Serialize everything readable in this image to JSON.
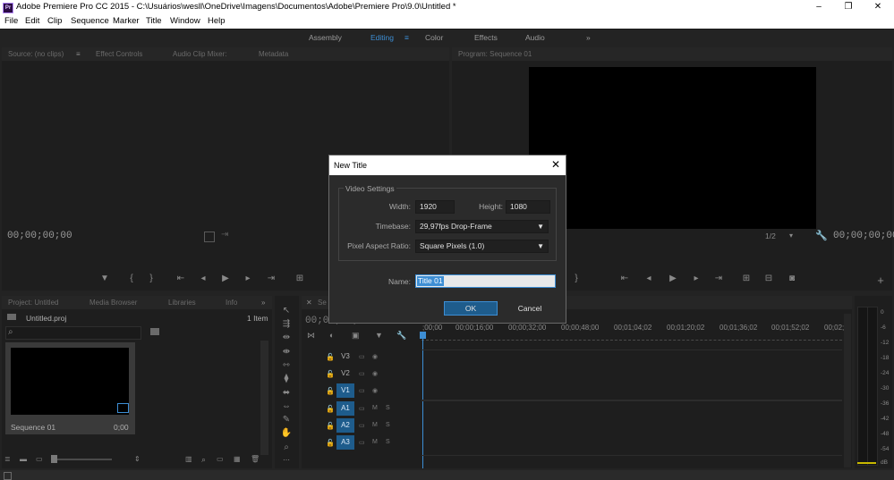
{
  "window": {
    "title": "Adobe Premiere Pro CC 2015 - C:\\Usuários\\wesll\\OneDrive\\Imagens\\Documentos\\Adobe\\Premiere Pro\\9.0\\Untitled *",
    "app_icon": "Pr",
    "minimize": "–",
    "restore": "❐",
    "close": "✕"
  },
  "menu": [
    "File",
    "Edit",
    "Clip",
    "Sequence",
    "Marker",
    "Title",
    "Window",
    "Help"
  ],
  "workspaces": {
    "items": [
      "Assembly",
      "Editing",
      "Color",
      "Effects",
      "Audio"
    ],
    "active": "Editing",
    "more": "»",
    "active_menu": "≡"
  },
  "source_panel": {
    "tabs": [
      "Source: (no clips)",
      "Effect Controls",
      "Audio Clip Mixer:",
      "Metadata"
    ],
    "tab_menu": "≡",
    "timecode": "00;00;00;00"
  },
  "program_panel": {
    "tab": "Program: Sequence 01",
    "timecode_right": "00;00;00;00",
    "zoom": "1/2",
    "add": "+"
  },
  "project_panel": {
    "tabs": [
      "Project: Untitled",
      "Media Browser",
      "Libraries",
      "Info"
    ],
    "more": "»",
    "file": "Untitled.proj",
    "count": "1 Item",
    "search_icon": "⌕",
    "thumb": {
      "name": "Sequence 01",
      "duration": "0;00"
    }
  },
  "timeline": {
    "tab_partial": "Se",
    "timecode_partial": "00;00;00;00",
    "ruler": [
      ";00;00",
      "00;00;16;00",
      "00;00;32;00",
      "00;00;48;00",
      "00;01;04;02",
      "00;01;20;02",
      "00;01;36;02",
      "00;01;52;02",
      "00;02;"
    ],
    "video_tracks": [
      "V3",
      "V2",
      "V1"
    ],
    "audio_tracks": [
      "A1",
      "A2",
      "A3"
    ],
    "active_tracks": [
      "V1",
      "A1",
      "A2",
      "A3"
    ],
    "m_label": "M",
    "s_label": "S"
  },
  "audio_meter": {
    "labels": [
      "0",
      "-6",
      "-12",
      "-18",
      "-24",
      "-30",
      "-36",
      "-42",
      "-48",
      "-54",
      "dB"
    ]
  },
  "dialog": {
    "title": "New Title",
    "close": "✕",
    "group_title": "Video Settings",
    "width_label": "Width:",
    "width_value": "1920",
    "height_label": "Height:",
    "height_value": "1080",
    "timebase_label": "Timebase:",
    "timebase_value": "29,97fps Drop-Frame",
    "par_label": "Pixel Aspect Ratio:",
    "par_value": "Square Pixels (1.0)",
    "name_label": "Name:",
    "name_value": "Title 01",
    "ok_label": "OK",
    "cancel_label": "Cancel"
  }
}
